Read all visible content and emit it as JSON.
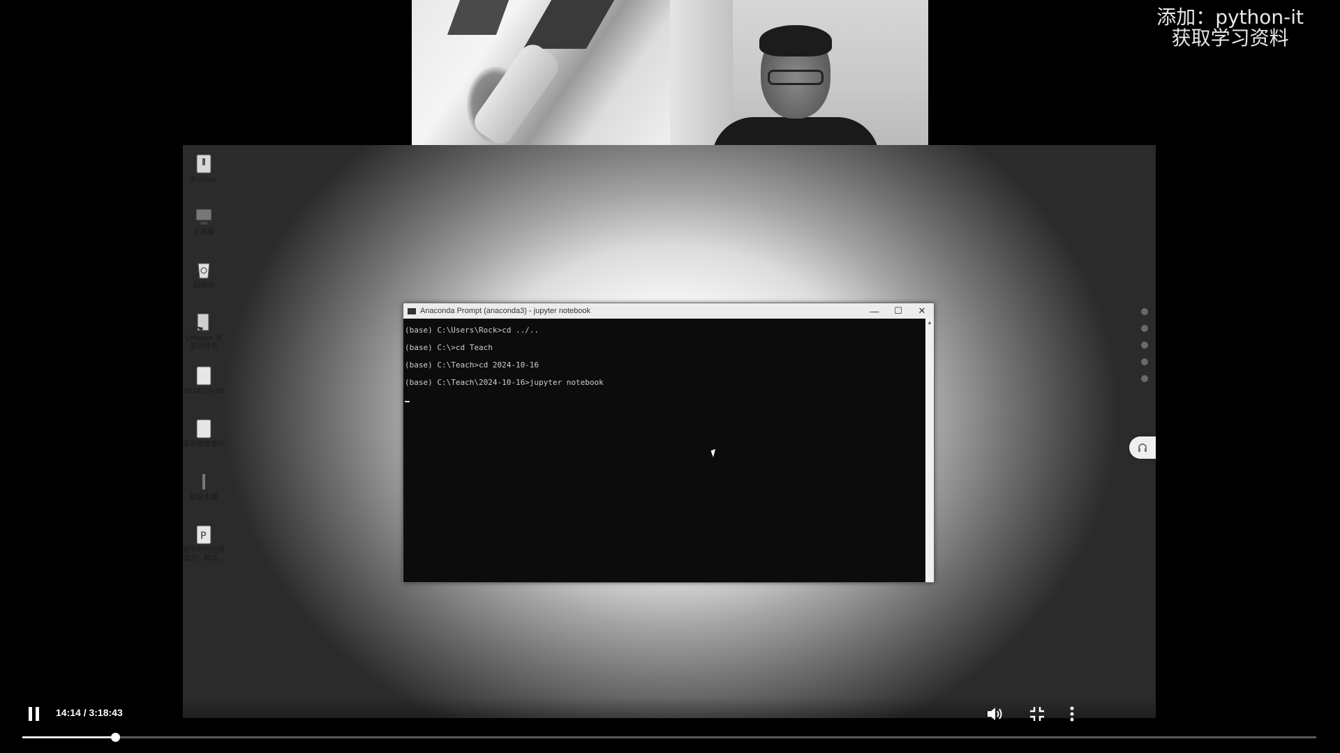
{
  "watermark": {
    "line1": "添加：python-it",
    "line2": "获取学习资料"
  },
  "desktop": {
    "icons": [
      {
        "label": "Backup",
        "icon": "folder-icon"
      },
      {
        "label": "此电脑",
        "icon": "computer-icon"
      },
      {
        "label": "回收站",
        "icon": "recycle-bin-icon"
      },
      {
        "label": "VMware 共享文件夹",
        "icon": "shared-folder-icon"
      },
      {
        "label": "2024-10-16",
        "icon": "folder-icon"
      },
      {
        "label": "渠道粘性提升",
        "icon": "folder-icon"
      },
      {
        "label": "就业大纲",
        "icon": "file-icon"
      },
      {
        "label": "数字时代的营销力：解读...",
        "icon": "powerpoint-icon"
      }
    ]
  },
  "console": {
    "title": "Anaconda Prompt (anaconda3) - jupyter  notebook",
    "minimize": "—",
    "maximize": "☐",
    "close": "✕",
    "lines": [
      "(base) C:\\Users\\Rock>cd ../..",
      "(base) C:\\>cd Teach",
      "(base) C:\\Teach>cd 2024-10-16",
      "(base) C:\\Teach\\2024-10-16>jupyter notebook"
    ]
  },
  "player": {
    "time": "14:14 / 3:18:43",
    "progress_fraction": 0.0715,
    "icons": {
      "play_pause": "pause-icon",
      "volume": "volume-icon",
      "fullscreen": "exit-fullscreen-icon",
      "more": "more-vertical-icon"
    }
  }
}
